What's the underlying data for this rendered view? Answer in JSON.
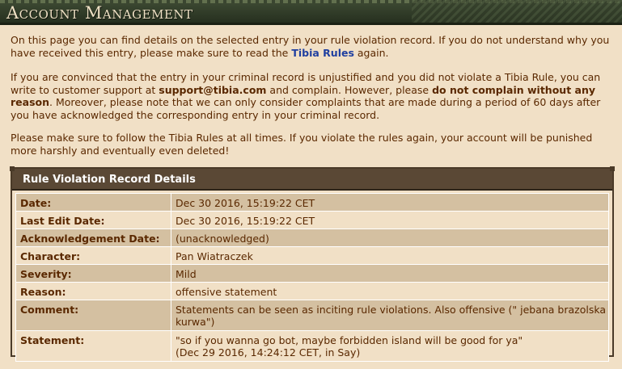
{
  "header": {
    "title": "Account Management"
  },
  "intro": {
    "p1_before": "On this page you can find details on the selected entry in your rule violation record. If you do not understand why you have received this entry, please make sure to read the ",
    "p1_link": "Tibia Rules",
    "p1_after": " again.",
    "p2_a": "If you are convinced that the entry in your criminal record is unjustified and you did not violate a Tibia Rule, you can write to customer support at ",
    "p2_email": "support@tibia.com",
    "p2_b": " and complain. However, please ",
    "p2_bold": "do not complain without any reason",
    "p2_c": ". Moreover, please note that we can only consider complaints that are made during a period of 60 days after you have acknowledged the corresponding entry in your criminal record.",
    "p3": "Please make sure to follow the Tibia Rules at all times. If you violate the rules again, your account will be punished more harshly and eventually even deleted!"
  },
  "record": {
    "title": "Rule Violation Record Details",
    "rows": [
      {
        "label": "Date:",
        "value": "Dec 30 2016, 15:19:22 CET"
      },
      {
        "label": "Last Edit Date:",
        "value": "Dec 30 2016, 15:19:22 CET"
      },
      {
        "label": "Acknowledgement Date:",
        "value": "(unacknowledged)"
      },
      {
        "label": "Character:",
        "value": "Pan Wiatraczek"
      },
      {
        "label": "Severity:",
        "value": "Mild"
      },
      {
        "label": "Reason:",
        "value": "offensive statement"
      },
      {
        "label": "Comment:",
        "value": "Statements can be seen as inciting rule violations. Also offensive (\" jebana brazolska kurwa\")"
      },
      {
        "label": "Statement:",
        "value": "\"so if you wanna go bot, maybe forbidden island will be good for ya\"",
        "value2": "(Dec 29 2016, 14:24:12 CET, in Say)"
      }
    ]
  }
}
